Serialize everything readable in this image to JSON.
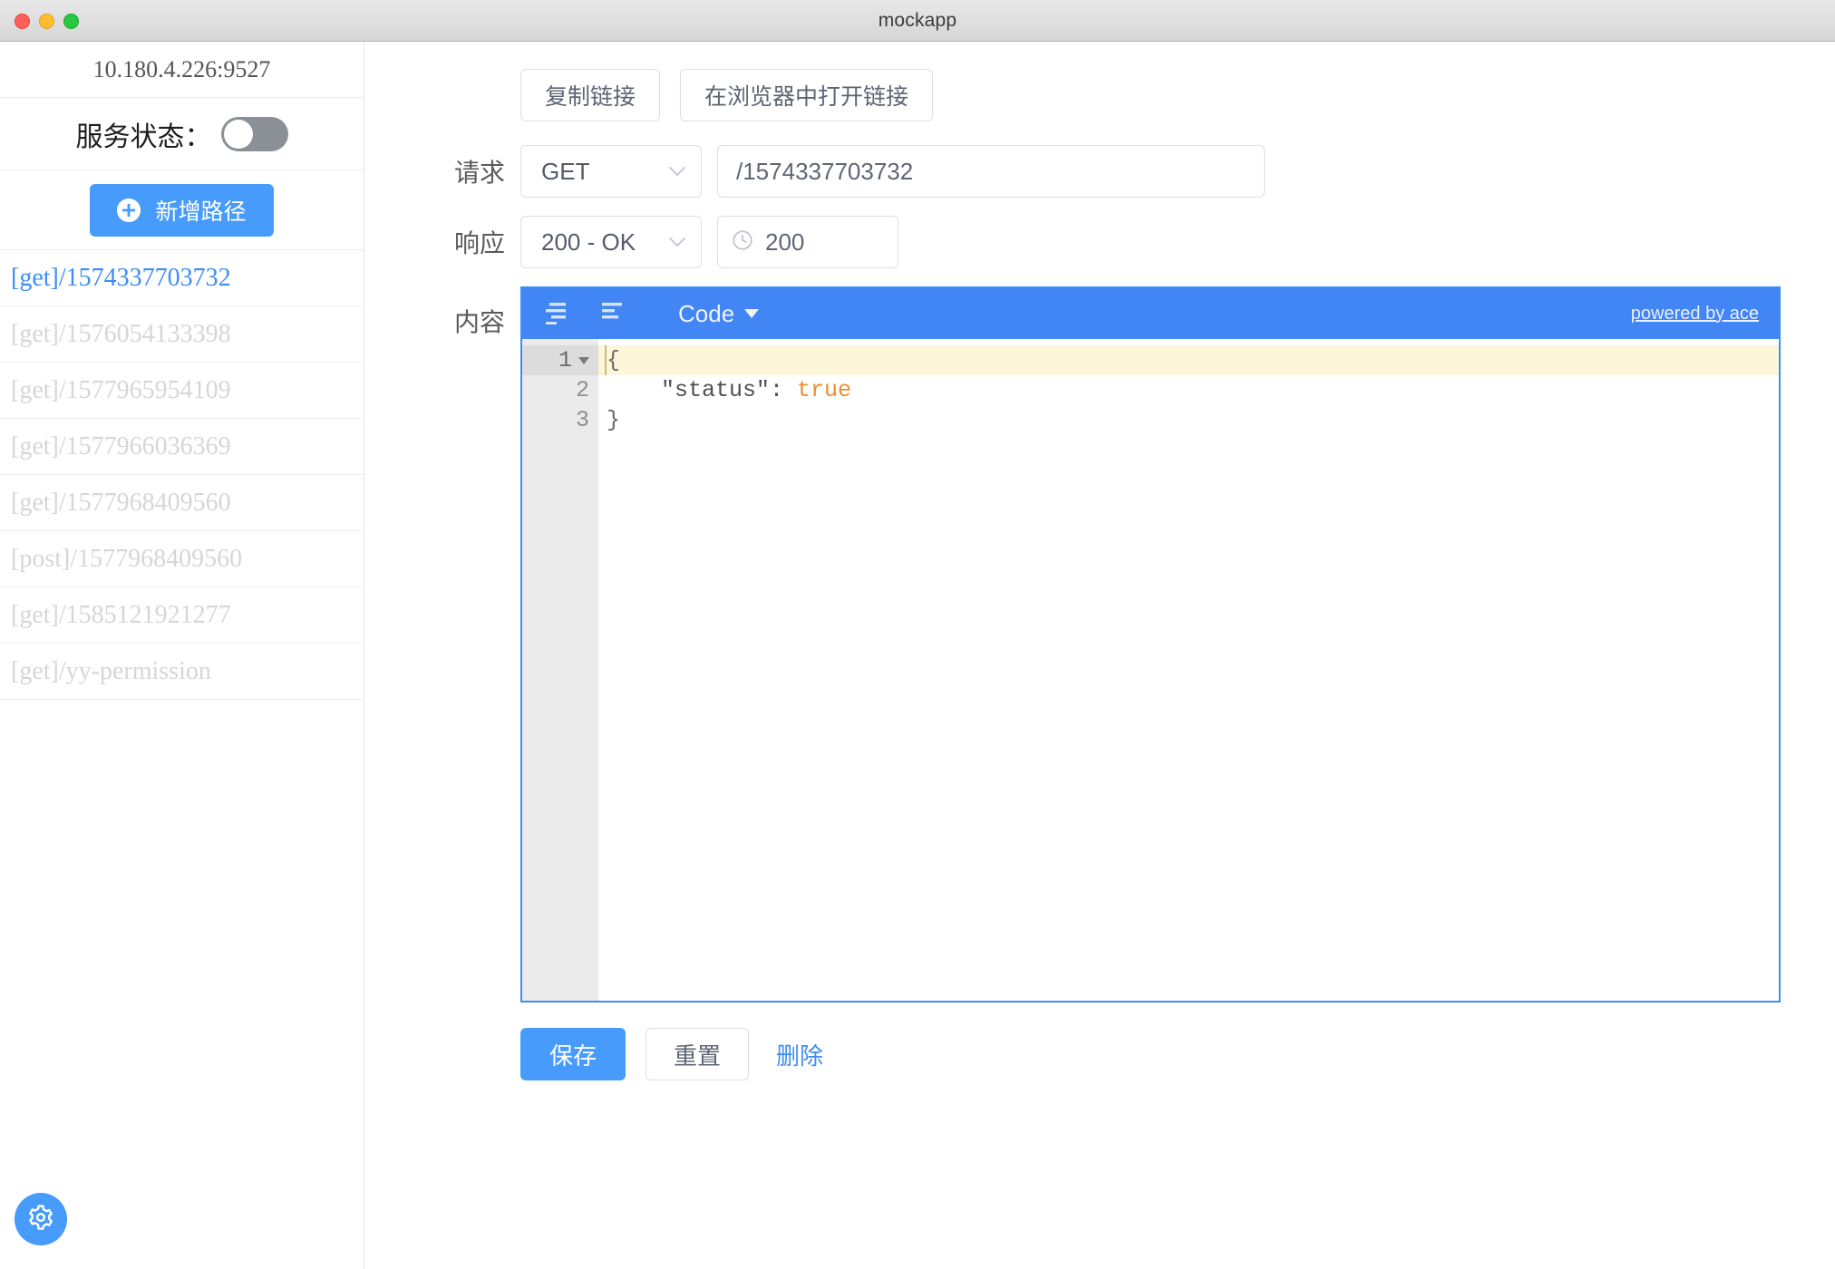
{
  "window": {
    "title": "mockapp",
    "traffic_lights": [
      "close",
      "minimize",
      "maximize"
    ]
  },
  "sidebar": {
    "host": "10.180.4.226:9527",
    "status_label": "服务状态：",
    "status_toggle": {
      "on": false,
      "off_color": "#8b8f96"
    },
    "add_button": "新增路径",
    "routes": [
      {
        "label": "[get]/1574337703732",
        "active": true
      },
      {
        "label": "[get]/1576054133398",
        "active": false
      },
      {
        "label": "[get]/1577965954109",
        "active": false
      },
      {
        "label": "[get]/1577966036369",
        "active": false
      },
      {
        "label": "[get]/1577968409560",
        "active": false
      },
      {
        "label": "[post]/1577968409560",
        "active": false
      },
      {
        "label": "[get]/1585121921277",
        "active": false
      },
      {
        "label": "[get]/yy-permission",
        "active": false
      }
    ],
    "settings_icon": "gear-icon"
  },
  "toolbar": {
    "copy_link": "复制链接",
    "open_in_browser": "在浏览器中打开链接"
  },
  "form": {
    "request_label": "请求",
    "method": "GET",
    "url": "/1574337703732",
    "url_placeholder": "",
    "response_label": "响应",
    "status": "200 - OK",
    "delay": "200",
    "delay_icon": "clock-icon",
    "content_label": "内容"
  },
  "editor": {
    "icons": [
      "format-align-right-icon",
      "format-align-left-icon"
    ],
    "mode": "Code",
    "ace_credit": "powered by ace",
    "toolbar_color": "#4285f4",
    "border_color": "#3d8df5",
    "lines": [
      {
        "number": "1",
        "fold": true,
        "active": true,
        "tokens": [
          {
            "t": "{",
            "c": "punc"
          }
        ]
      },
      {
        "number": "2",
        "fold": false,
        "active": false,
        "tokens": [
          {
            "t": "    \"status\": ",
            "c": "key"
          },
          {
            "t": "true",
            "c": "bool"
          }
        ]
      },
      {
        "number": "3",
        "fold": false,
        "active": false,
        "tokens": [
          {
            "t": "}",
            "c": "punc"
          }
        ]
      }
    ]
  },
  "footer": {
    "save": "保存",
    "reset": "重置",
    "delete": "删除"
  },
  "colors": {
    "accent": "#469bfb",
    "link": "#3d8df5",
    "editor_header": "#4285f4",
    "active_line": "#fdf6d8",
    "bool_token": "#f08c2e"
  }
}
